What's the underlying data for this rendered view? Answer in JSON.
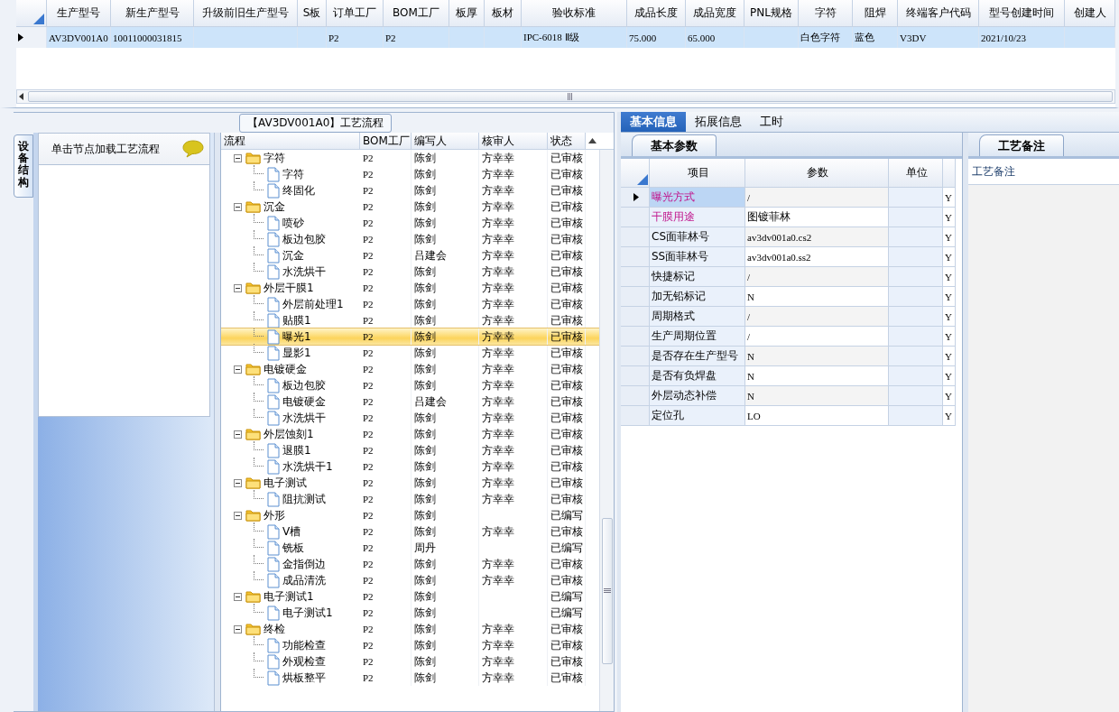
{
  "main_table": {
    "columns": [
      "生产型号",
      "新生产型号",
      "升级前旧生产型号",
      "S板",
      "订单工厂",
      "BOM工厂",
      "板厚",
      "板材",
      "验收标准",
      "成品长度",
      "成品宽度",
      "PNL规格",
      "字符",
      "阻焊",
      "终端客户代码",
      "型号创建时间",
      "创建人"
    ],
    "rows": [
      {
        "selected": true,
        "cells": [
          "AV3DV001A0",
          "10011000031815",
          "",
          "",
          "P2",
          "P2",
          "",
          "",
          "IPC-6018 Ⅱ级",
          "75.000",
          "65.000",
          "",
          "白色字符",
          "蓝色",
          "V3DV",
          "2021/10/23",
          ""
        ]
      }
    ]
  },
  "left_panel": {
    "vertical_tab": "设备结构",
    "header": "单击节点加载工艺流程"
  },
  "flow": {
    "title": "【AV3DV001A0】工艺流程",
    "columns": [
      "流程",
      "BOM工厂",
      "编写人",
      "核审人",
      "状态"
    ],
    "rows": [
      {
        "label": "字符",
        "factory": "P2",
        "writer": "陈剑",
        "reviewer": "方幸幸",
        "status": "已审核",
        "expanded": true,
        "selected": false,
        "children": [
          {
            "label": "字符",
            "factory": "P2",
            "writer": "陈剑",
            "reviewer": "方幸幸",
            "status": "已审核",
            "selected": false
          },
          {
            "label": "终固化",
            "factory": "P2",
            "writer": "陈剑",
            "reviewer": "方幸幸",
            "status": "已审核",
            "selected": false
          }
        ]
      },
      {
        "label": "沉金",
        "factory": "P2",
        "writer": "陈剑",
        "reviewer": "方幸幸",
        "status": "已审核",
        "expanded": true,
        "selected": false,
        "children": [
          {
            "label": "喷砂",
            "factory": "P2",
            "writer": "陈剑",
            "reviewer": "方幸幸",
            "status": "已审核",
            "selected": false
          },
          {
            "label": "板边包胶",
            "factory": "P2",
            "writer": "陈剑",
            "reviewer": "方幸幸",
            "status": "已审核",
            "selected": false
          },
          {
            "label": "沉金",
            "factory": "P2",
            "writer": "吕建会",
            "reviewer": "方幸幸",
            "status": "已审核",
            "selected": false
          },
          {
            "label": "水洗烘干",
            "factory": "P2",
            "writer": "陈剑",
            "reviewer": "方幸幸",
            "status": "已审核",
            "selected": false
          }
        ]
      },
      {
        "label": "外层干膜1",
        "factory": "P2",
        "writer": "陈剑",
        "reviewer": "方幸幸",
        "status": "已审核",
        "expanded": true,
        "selected": false,
        "children": [
          {
            "label": "外层前处理1",
            "factory": "P2",
            "writer": "陈剑",
            "reviewer": "方幸幸",
            "status": "已审核",
            "selected": false
          },
          {
            "label": "贴膜1",
            "factory": "P2",
            "writer": "陈剑",
            "reviewer": "方幸幸",
            "status": "已审核",
            "selected": false
          },
          {
            "label": "曝光1",
            "factory": "P2",
            "writer": "陈剑",
            "reviewer": "方幸幸",
            "status": "已审核",
            "selected": true
          },
          {
            "label": "显影1",
            "factory": "P2",
            "writer": "陈剑",
            "reviewer": "方幸幸",
            "status": "已审核",
            "selected": false
          }
        ]
      },
      {
        "label": "电镀硬金",
        "factory": "P2",
        "writer": "陈剑",
        "reviewer": "方幸幸",
        "status": "已审核",
        "expanded": true,
        "selected": false,
        "children": [
          {
            "label": "板边包胶",
            "factory": "P2",
            "writer": "陈剑",
            "reviewer": "方幸幸",
            "status": "已审核",
            "selected": false
          },
          {
            "label": "电镀硬金",
            "factory": "P2",
            "writer": "吕建会",
            "reviewer": "方幸幸",
            "status": "已审核",
            "selected": false
          },
          {
            "label": "水洗烘干",
            "factory": "P2",
            "writer": "陈剑",
            "reviewer": "方幸幸",
            "status": "已审核",
            "selected": false
          }
        ]
      },
      {
        "label": "外层蚀刻1",
        "factory": "P2",
        "writer": "陈剑",
        "reviewer": "方幸幸",
        "status": "已审核",
        "expanded": true,
        "selected": false,
        "children": [
          {
            "label": "退膜1",
            "factory": "P2",
            "writer": "陈剑",
            "reviewer": "方幸幸",
            "status": "已审核",
            "selected": false
          },
          {
            "label": "水洗烘干1",
            "factory": "P2",
            "writer": "陈剑",
            "reviewer": "方幸幸",
            "status": "已审核",
            "selected": false
          }
        ]
      },
      {
        "label": "电子测试",
        "factory": "P2",
        "writer": "陈剑",
        "reviewer": "方幸幸",
        "status": "已审核",
        "expanded": true,
        "selected": false,
        "children": [
          {
            "label": "阻抗测试",
            "factory": "P2",
            "writer": "陈剑",
            "reviewer": "方幸幸",
            "status": "已审核",
            "selected": false
          }
        ]
      },
      {
        "label": "外形",
        "factory": "P2",
        "writer": "陈剑",
        "status": "已编写",
        "expanded": true,
        "selected": false,
        "children": [
          {
            "label": "V槽",
            "factory": "P2",
            "writer": "陈剑",
            "reviewer": "方幸幸",
            "status": "已审核",
            "selected": false
          },
          {
            "label": "铣板",
            "factory": "P2",
            "writer": "周丹",
            "status": "已编写",
            "selected": false
          },
          {
            "label": "金指倒边",
            "factory": "P2",
            "writer": "陈剑",
            "reviewer": "方幸幸",
            "status": "已审核",
            "selected": false
          },
          {
            "label": "成品清洗",
            "factory": "P2",
            "writer": "陈剑",
            "reviewer": "方幸幸",
            "status": "已审核",
            "selected": false
          }
        ]
      },
      {
        "label": "电子测试1",
        "factory": "P2",
        "writer": "陈剑",
        "status": "已编写",
        "expanded": true,
        "selected": false,
        "children": [
          {
            "label": "电子测试1",
            "factory": "P2",
            "writer": "陈剑",
            "status": "已编写",
            "selected": false
          }
        ]
      },
      {
        "label": "终检",
        "factory": "P2",
        "writer": "陈剑",
        "reviewer": "方幸幸",
        "status": "已审核",
        "expanded": true,
        "selected": false,
        "children": [
          {
            "label": "功能检查",
            "factory": "P2",
            "writer": "陈剑",
            "reviewer": "方幸幸",
            "status": "已审核",
            "selected": false
          },
          {
            "label": "外观检查",
            "factory": "P2",
            "writer": "陈剑",
            "reviewer": "方幸幸",
            "status": "已审核",
            "selected": false
          },
          {
            "label": "烘板整平",
            "factory": "P2",
            "writer": "陈剑",
            "reviewer": "方幸幸",
            "status": "已审核",
            "selected": false
          }
        ]
      }
    ]
  },
  "detail_tabs": [
    {
      "label": "基本信息",
      "selected": true
    },
    {
      "label": "拓展信息",
      "selected": false
    },
    {
      "label": "工时",
      "selected": false
    }
  ],
  "params": {
    "tab": "基本参数",
    "columns": [
      "项目",
      "参数",
      "单位"
    ],
    "rows": [
      {
        "item": "曝光方式",
        "value": "/",
        "flag": "Y",
        "required": true,
        "selected": true
      },
      {
        "item": "干膜用途",
        "value": "图镀菲林",
        "flag": "Y",
        "required": true,
        "selected": false
      },
      {
        "item": "CS面菲林号",
        "value": "av3dv001a0.cs2",
        "flag": "Y",
        "required": false,
        "selected": false
      },
      {
        "item": "SS面菲林号",
        "value": "av3dv001a0.ss2",
        "flag": "Y",
        "required": false,
        "selected": false
      },
      {
        "item": "快捷标记",
        "value": "/",
        "flag": "Y",
        "required": false,
        "selected": false
      },
      {
        "item": "加无铅标记",
        "value": "N",
        "flag": "Y",
        "required": false,
        "selected": false
      },
      {
        "item": "周期格式",
        "value": "/",
        "flag": "Y",
        "required": false,
        "selected": false
      },
      {
        "item": "生产周期位置",
        "value": "/",
        "flag": "Y",
        "required": false,
        "selected": false
      },
      {
        "item": "是否存在生产型号",
        "value": "N",
        "flag": "Y",
        "required": false,
        "selected": false
      },
      {
        "item": "是否有负焊盘",
        "value": "N",
        "flag": "Y",
        "required": false,
        "selected": false
      },
      {
        "item": "外层动态补偿",
        "value": "N",
        "flag": "Y",
        "required": false,
        "selected": false
      },
      {
        "item": "定位孔",
        "value": "LO",
        "flag": "Y",
        "required": false,
        "selected": false
      }
    ]
  },
  "notes": {
    "tab": "工艺备注",
    "label": "工艺备注"
  }
}
